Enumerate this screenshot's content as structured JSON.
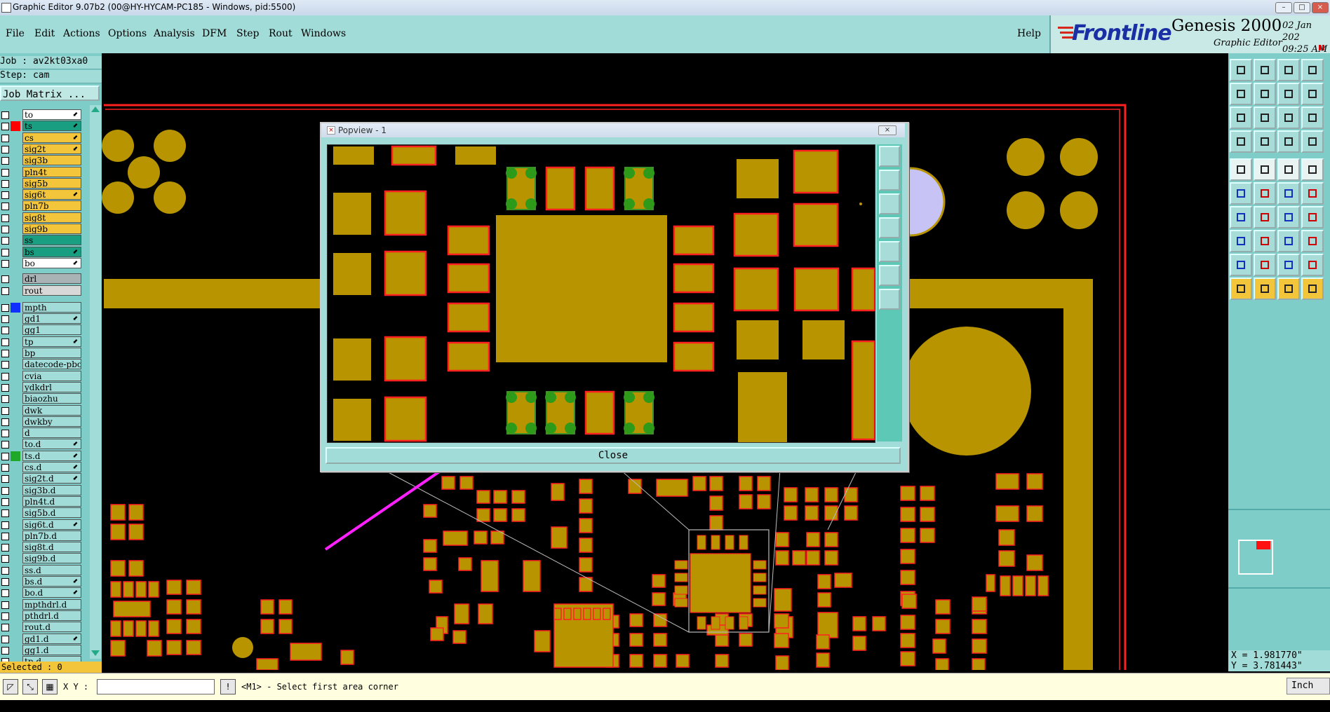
{
  "window": {
    "title": "Graphic Editor 9.07b2 (00@HY-HYCAM-PC185 - Windows, pid:5500)",
    "controls": [
      "–",
      "□",
      "×"
    ]
  },
  "menu": [
    "File",
    "Edit",
    "Actions",
    "Options",
    "Analysis",
    "DFM",
    "Step",
    "Rout",
    "Windows"
  ],
  "help_label": "Help",
  "brand": {
    "logo": "Frontline",
    "product": "Genesis 2000",
    "subtitle": "Graphic Editor",
    "date": "02 Jan 202",
    "time": "09:25 AM"
  },
  "job": {
    "job_line": "Job : av2kt03xa0",
    "step_line": "Step: cam",
    "matrix_button": "Job Matrix ..."
  },
  "layers": [
    {
      "name": "to",
      "color": "#ffffff",
      "swatch": "",
      "arrow": true
    },
    {
      "name": "ts",
      "color": "#1a9e82",
      "swatch": "#ff0000",
      "arrow": true
    },
    {
      "name": "cs",
      "color": "#f2c53a",
      "swatch": "",
      "arrow": true
    },
    {
      "name": "sig2t",
      "color": "#f2c53a",
      "swatch": "",
      "arrow": true
    },
    {
      "name": "sig3b",
      "color": "#f2c53a",
      "swatch": "",
      "arrow": false
    },
    {
      "name": "pln4t",
      "color": "#f2c53a",
      "swatch": "",
      "arrow": false
    },
    {
      "name": "sig5b",
      "color": "#f2c53a",
      "swatch": "",
      "arrow": false
    },
    {
      "name": "sig6t",
      "color": "#f2c53a",
      "swatch": "",
      "arrow": true
    },
    {
      "name": "pln7b",
      "color": "#f2c53a",
      "swatch": "",
      "arrow": false
    },
    {
      "name": "sig8t",
      "color": "#f2c53a",
      "swatch": "",
      "arrow": false
    },
    {
      "name": "sig9b",
      "color": "#f2c53a",
      "swatch": "",
      "arrow": false
    },
    {
      "name": "ss",
      "color": "#1a9e82",
      "swatch": "",
      "arrow": false
    },
    {
      "name": "bs",
      "color": "#1a9e82",
      "swatch": "",
      "arrow": true
    },
    {
      "name": "bo",
      "color": "#ffffff",
      "swatch": "",
      "arrow": true
    }
  ],
  "drill_layers": [
    {
      "name": "drl",
      "color": "#a9b3b6"
    },
    {
      "name": "rout",
      "color": "#d8d8d8"
    }
  ],
  "other_layers": [
    {
      "name": "mpth",
      "swatch": "#1030ff",
      "arrow": false
    },
    {
      "name": "gd1",
      "swatch": "",
      "arrow": true
    },
    {
      "name": "gg1",
      "swatch": "",
      "arrow": false
    },
    {
      "name": "tp",
      "swatch": "",
      "arrow": true
    },
    {
      "name": "bp",
      "swatch": "",
      "arrow": false
    },
    {
      "name": "datecode-pbo",
      "swatch": "",
      "arrow": false
    },
    {
      "name": "cvia",
      "swatch": "",
      "arrow": false
    },
    {
      "name": "ydkdrl",
      "swatch": "",
      "arrow": false
    },
    {
      "name": "biaozhu",
      "swatch": "",
      "arrow": false
    },
    {
      "name": "dwk",
      "swatch": "",
      "arrow": false
    },
    {
      "name": "dwkby",
      "swatch": "",
      "arrow": false
    },
    {
      "name": "d",
      "swatch": "",
      "arrow": false
    },
    {
      "name": "to.d",
      "swatch": "",
      "arrow": true
    },
    {
      "name": "ts.d",
      "swatch": "#1fa82a",
      "arrow": true
    },
    {
      "name": "cs.d",
      "swatch": "",
      "arrow": true
    },
    {
      "name": "sig2t.d",
      "swatch": "",
      "arrow": true
    },
    {
      "name": "sig3b.d",
      "swatch": "",
      "arrow": false
    },
    {
      "name": "pln4t.d",
      "swatch": "",
      "arrow": false
    },
    {
      "name": "sig5b.d",
      "swatch": "",
      "arrow": false
    },
    {
      "name": "sig6t.d",
      "swatch": "",
      "arrow": true
    },
    {
      "name": "pln7b.d",
      "swatch": "",
      "arrow": false
    },
    {
      "name": "sig8t.d",
      "swatch": "",
      "arrow": false
    },
    {
      "name": "sig9b.d",
      "swatch": "",
      "arrow": false
    },
    {
      "name": "ss.d",
      "swatch": "",
      "arrow": false
    },
    {
      "name": "bs.d",
      "swatch": "",
      "arrow": true
    },
    {
      "name": "bo.d",
      "swatch": "",
      "arrow": true
    },
    {
      "name": "mpthdrl.d",
      "swatch": "",
      "arrow": false
    },
    {
      "name": "pthdrl.d",
      "swatch": "",
      "arrow": false
    },
    {
      "name": "rout.d",
      "swatch": "",
      "arrow": false
    },
    {
      "name": "gd1.d",
      "swatch": "",
      "arrow": true
    },
    {
      "name": "gg1.d",
      "swatch": "",
      "arrow": false
    },
    {
      "name": "tp.d",
      "swatch": "",
      "arrow": false
    }
  ],
  "selected_label": "Selected : 0",
  "popview": {
    "title": "Popview - 1",
    "close_label": "Close"
  },
  "coords": {
    "x": "X = 1.981770\"",
    "y": "Y = 3.781443\""
  },
  "status": {
    "xy_label": "X Y :",
    "xy_value": "",
    "prompt": "<M1> - Select first area corner",
    "units": "Inch"
  },
  "colors": {
    "pad": "#b89400",
    "pad_outline": "#ff2020",
    "teal": "#a2dcd8",
    "arrow": "#ff20ff"
  },
  "toolbar_icons": [
    "zoom-home-icon",
    "zoom-in-icon",
    "zoom-out-icon",
    "fit-icon",
    "pan-left-icon",
    "pan-right-icon",
    "mirror-icon",
    "rotate-icon",
    "center-icon",
    "zoom-window-icon",
    "scale-icon",
    "help-icon",
    "measure-icon",
    "grid-icon",
    "snap-icon",
    "filter-icon",
    "add-pad-icon",
    "add-line-icon",
    "add-surface-icon",
    "add-text-icon",
    "connect-icon",
    "cross-icon",
    "arc-icon",
    "move-icon",
    "line-icon",
    "line2-icon",
    "arc2-icon",
    "move2-icon",
    "pad-edit-icon",
    "split-icon",
    "break-icon",
    "resize-icon",
    "tri-icon",
    "tri2-icon",
    "tri3-icon",
    "tri4-icon",
    "select-icon",
    "select2-icon",
    "select3-icon",
    "select4-icon"
  ]
}
